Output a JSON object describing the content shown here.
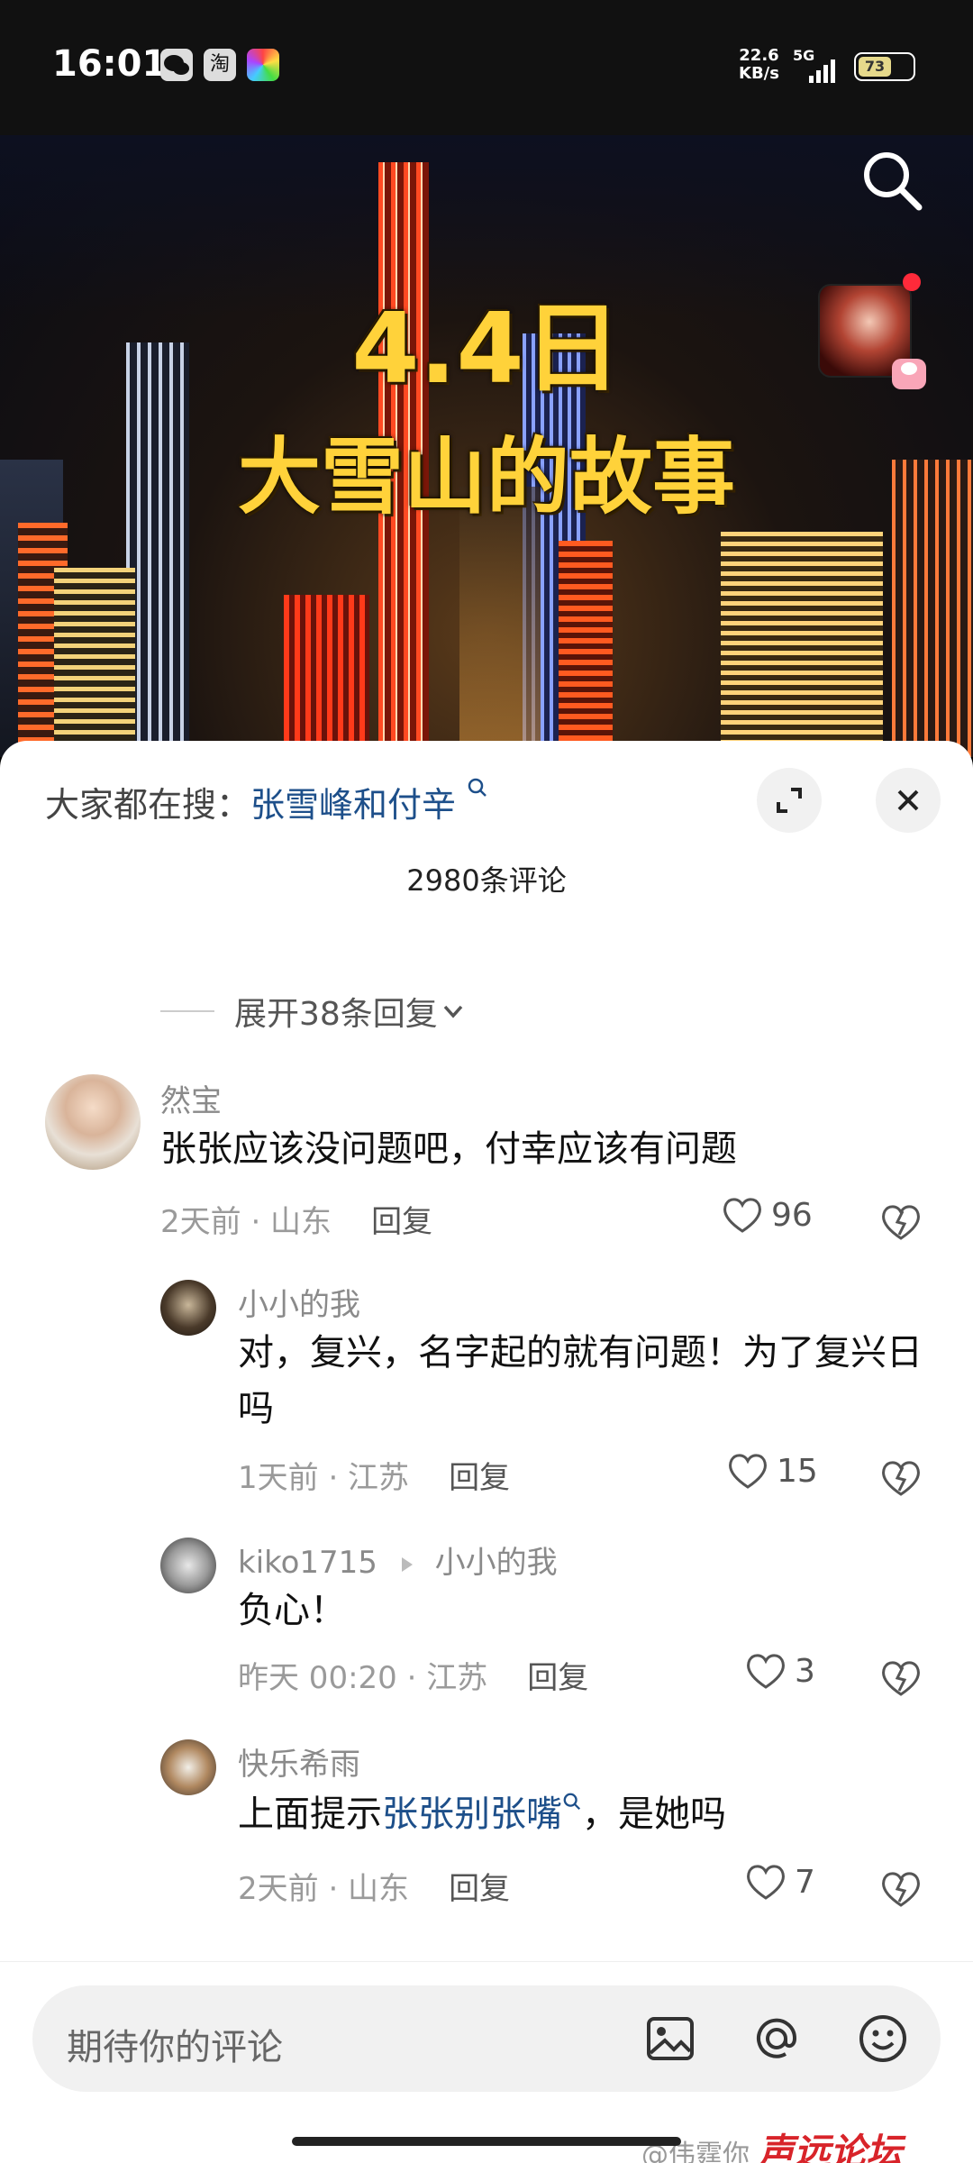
{
  "status_bar": {
    "time": "16:01",
    "app_icons": [
      "wechat-icon",
      "taobao-icon",
      "photos-icon"
    ],
    "taobao_glyph": "淘",
    "net_speed": "22.6",
    "net_unit": "KB/s",
    "network": "5G",
    "battery_label": "73"
  },
  "video": {
    "title_line1": "4.4日",
    "title_line2": "大雪山的故事"
  },
  "sheet": {
    "hot_search_label": "大家都在搜：",
    "hot_search_keyword": "张雪峰和付辛",
    "comment_count": "2980条评论",
    "expand_replies": "展开38条回复"
  },
  "comments": [
    {
      "user": "然宝",
      "text": "张张应该没问题吧，付幸应该有问题",
      "time_loc": "2天前 · 山东",
      "reply_label": "回复",
      "likes": "96"
    },
    {
      "user": "小小的我",
      "text": "对，复兴，名字起的就有问题！为了复兴日吗",
      "time_loc": "1天前 · 江苏",
      "reply_label": "回复",
      "likes": "15"
    },
    {
      "user": "kiko1715",
      "reply_to": "小小的我",
      "text": "负心！",
      "time_loc": "昨天 00:20 · 江苏",
      "reply_label": "回复",
      "likes": "3"
    },
    {
      "user": "快乐希雨",
      "text_prefix": "上面提示",
      "text_keyword": "张张别张嘴",
      "text_suffix": "，是她吗",
      "time_loc": "2天前 · 山东",
      "reply_label": "回复",
      "likes": "7"
    }
  ],
  "input_bar": {
    "placeholder": "期待你的评论"
  },
  "watermark": {
    "handle": "@伟霆你",
    "brand": "声远论坛"
  },
  "colors": {
    "title_yellow": "#ffd23a",
    "keyword_blue": "#1d4f8a",
    "live_red": "#ff2a3a"
  }
}
